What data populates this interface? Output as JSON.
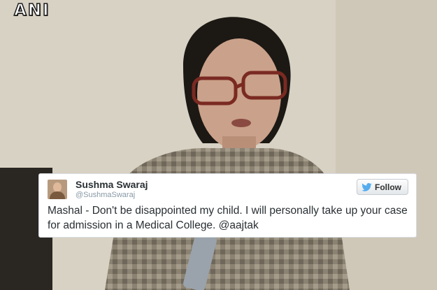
{
  "watermark": {
    "text": "ANI"
  },
  "tweet": {
    "avatar_icon": "user-avatar",
    "name": "Sushma Swaraj",
    "handle": "@SushmaSwaraj",
    "follow_label": "Follow",
    "follow_icon": "twitter-bird-icon",
    "text": "Mashal - Don't be disappointed my child. I will personally take up your case for admission in a Medical College. @aajtak"
  },
  "colors": {
    "bird": "#55acee",
    "card_bg": "#ffffff",
    "name": "#292f33",
    "handle": "#8899a6"
  }
}
